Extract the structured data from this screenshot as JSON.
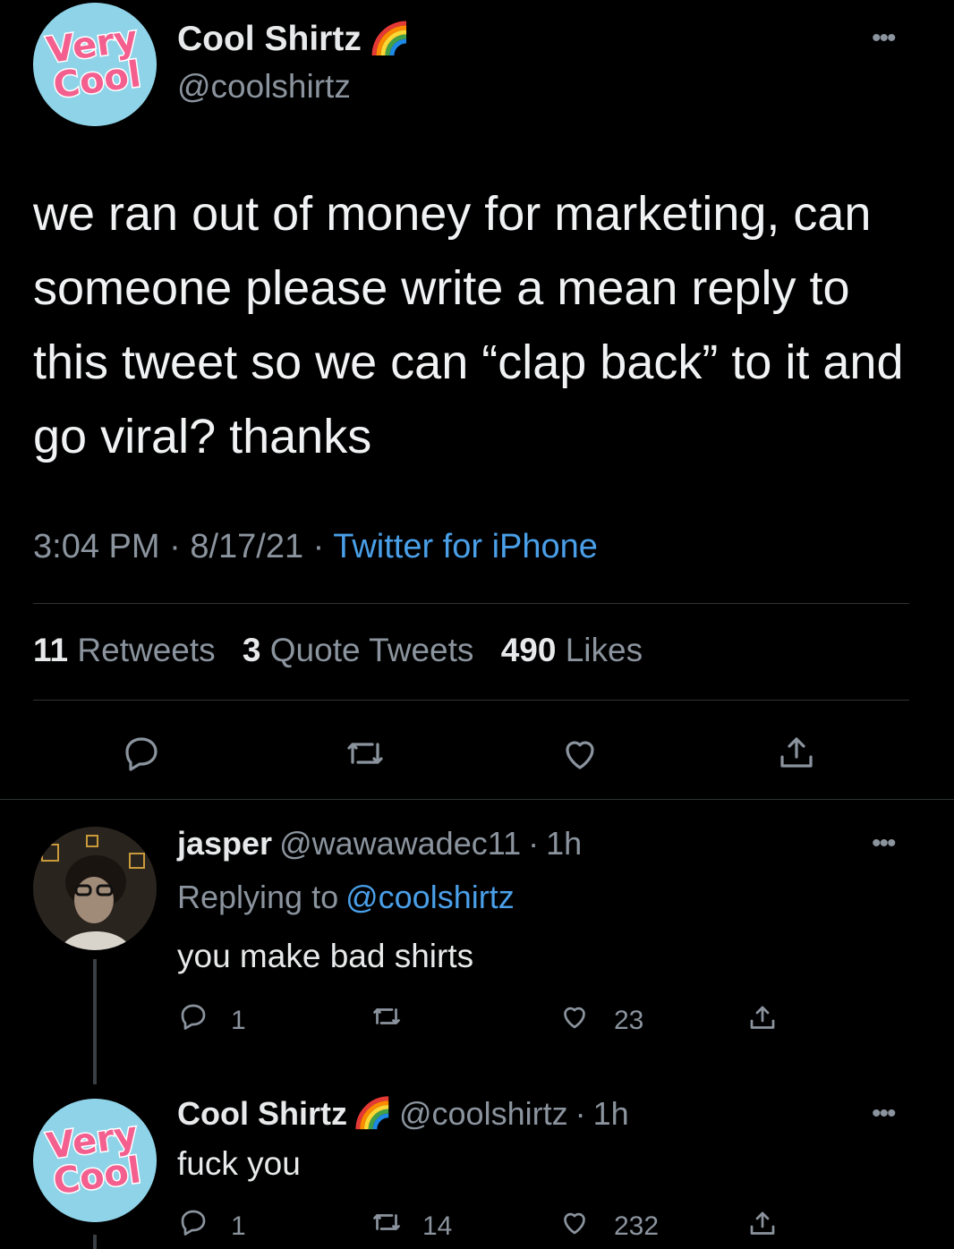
{
  "main_tweet": {
    "display_name": "Cool Shirtz",
    "handle": "@coolshirtz",
    "avatar_text_top": "Very",
    "avatar_text_bottom": "Cool",
    "text": "we ran out of money for marketing, can someone please write a mean reply to this tweet so we can “clap back” to it and go viral? thanks",
    "time": "3:04 PM",
    "date": "8/17/21",
    "separator": "·",
    "source": "Twitter for iPhone",
    "stats": {
      "retweets_count": "11",
      "retweets_label": "Retweets",
      "quotes_count": "3",
      "quotes_label": "Quote Tweets",
      "likes_count": "490",
      "likes_label": "Likes"
    }
  },
  "reply_1": {
    "display_name": "jasper",
    "handle": "@wawawadec11",
    "time": "1h",
    "replying_label": "Replying to",
    "replying_handle": "@coolshirtz",
    "text": "you make bad shirts",
    "reply_count": "1",
    "like_count": "23"
  },
  "reply_2": {
    "display_name": "Cool Shirtz",
    "handle": "@coolshirtz",
    "time": "1h",
    "text": "fuck you",
    "reply_count": "1",
    "retweet_count": "14",
    "like_count": "232"
  },
  "colors": {
    "background": "#000000",
    "link": "#4a9fe8",
    "muted": "#8b949e",
    "avatar_bg": "#8fd3e8",
    "avatar_text": "#f3608f"
  },
  "icons": [
    "rainbow-icon",
    "more-icon",
    "reply-icon",
    "retweet-icon",
    "like-icon",
    "share-icon"
  ]
}
